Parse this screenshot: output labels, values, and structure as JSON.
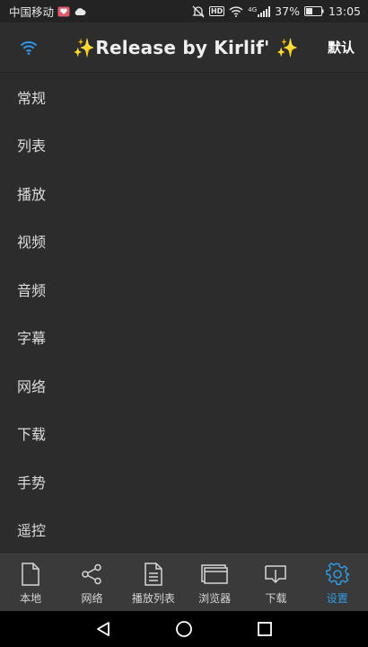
{
  "status_bar": {
    "carrier": "中国移动",
    "hd": "HD",
    "network": "4G",
    "battery": "37%",
    "time": "13:05"
  },
  "header": {
    "title": "✨Release by Kirlif' ✨",
    "default_label": "默认"
  },
  "settings": {
    "items": [
      {
        "label": "常规"
      },
      {
        "label": "列表"
      },
      {
        "label": "播放"
      },
      {
        "label": "视频"
      },
      {
        "label": "音频"
      },
      {
        "label": "字幕"
      },
      {
        "label": "网络"
      },
      {
        "label": "下载"
      },
      {
        "label": "手势"
      },
      {
        "label": "遥控"
      }
    ]
  },
  "bottom_nav": {
    "tabs": [
      {
        "label": "本地",
        "icon": "file-icon"
      },
      {
        "label": "网络",
        "icon": "share-icon"
      },
      {
        "label": "播放列表",
        "icon": "playlist-icon"
      },
      {
        "label": "浏览器",
        "icon": "browser-icon"
      },
      {
        "label": "下载",
        "icon": "download-icon"
      },
      {
        "label": "设置",
        "icon": "gear-icon",
        "active": true
      }
    ],
    "active_color": "#2f9be8"
  }
}
